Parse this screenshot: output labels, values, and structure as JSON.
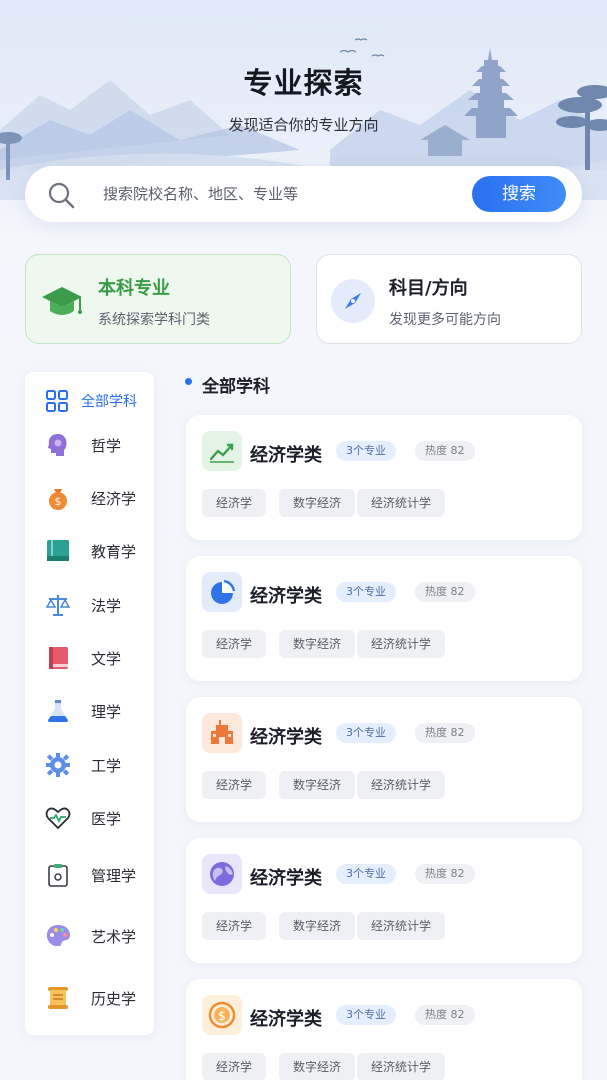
{
  "header": {
    "title": "专业探索",
    "subtitle": "发现适合你的专业方向"
  },
  "search": {
    "placeholder": "搜索院校名称、地区、专业等",
    "button_label": "搜索"
  },
  "modes": [
    {
      "title": "本科专业",
      "subtitle": "系统探索学科门类",
      "icon": "graduation-cap-icon",
      "active": true
    },
    {
      "title": "科目/方向",
      "subtitle": "发现更多可能方向",
      "icon": "compass-icon",
      "active": false
    }
  ],
  "sidebar": {
    "items": [
      {
        "label": "全部学科",
        "icon": "grid-icon",
        "active": true
      },
      {
        "label": "哲学",
        "icon": "head-icon"
      },
      {
        "label": "经济学",
        "icon": "money-bag-icon"
      },
      {
        "label": "教育学",
        "icon": "book-icon"
      },
      {
        "label": "法学",
        "icon": "scales-icon"
      },
      {
        "label": "文学",
        "icon": "red-book-icon"
      },
      {
        "label": "理学",
        "icon": "flask-icon"
      },
      {
        "label": "工学",
        "icon": "gear-icon"
      },
      {
        "label": "医学",
        "icon": "heart-pulse-icon"
      },
      {
        "label": "管理学",
        "icon": "clipboard-icon"
      },
      {
        "label": "艺术学",
        "icon": "palette-icon"
      },
      {
        "label": "历史学",
        "icon": "scroll-icon"
      }
    ]
  },
  "content": {
    "section_title": "全部学科",
    "majors": [
      {
        "name": "经济学类",
        "count": "3个专业",
        "heat": "热度 82",
        "icon": "trend-chart-icon",
        "tags": [
          "经济学",
          "数字经济",
          "经济统计学"
        ]
      },
      {
        "name": "经济学类",
        "count": "3个专业",
        "heat": "热度 82",
        "icon": "pie-chart-icon",
        "tags": [
          "经济学",
          "数字经济",
          "经济统计学"
        ]
      },
      {
        "name": "经济学类",
        "count": "3个专业",
        "heat": "热度 82",
        "icon": "building-icon",
        "tags": [
          "经济学",
          "数字经济",
          "经济统计学"
        ]
      },
      {
        "name": "经济学类",
        "count": "3个专业",
        "heat": "热度 82",
        "icon": "globe-icon",
        "tags": [
          "经济学",
          "数字经济",
          "经济统计学"
        ]
      },
      {
        "name": "经济学类",
        "count": "3个专业",
        "heat": "热度 82",
        "icon": "coin-icon",
        "tags": [
          "经济学",
          "数字经济",
          "经济统计学"
        ]
      }
    ]
  },
  "colors": {
    "accent": "#2a6ff0",
    "active_card_bg": "#eef8ee",
    "active_card_text": "#3a9b46"
  }
}
